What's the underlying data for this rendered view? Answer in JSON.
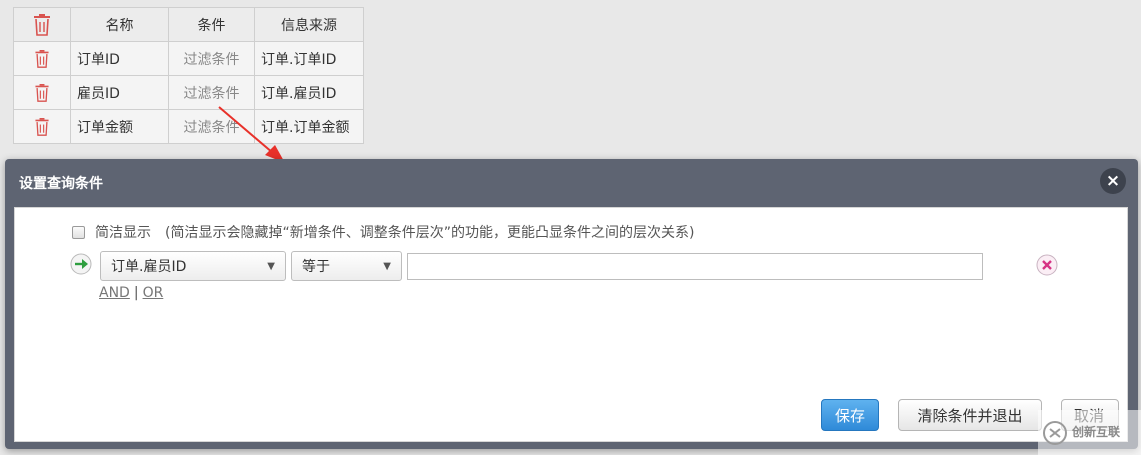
{
  "table": {
    "headers": {
      "name": "名称",
      "condition": "条件",
      "source": "信息来源"
    },
    "rows": [
      {
        "name": "订单ID",
        "condition": "过滤条件",
        "source": "订单.订单ID"
      },
      {
        "name": "雇员ID",
        "condition": "过滤条件",
        "source": "订单.雇员ID"
      },
      {
        "name": "订单金额",
        "condition": "过滤条件",
        "source": "订单.订单金额"
      }
    ]
  },
  "dialog": {
    "title": "设置查询条件",
    "close_label": "×",
    "simple_display": {
      "checked": false,
      "label": "简洁显示",
      "hint": "(简洁显示会隐藏掉“新增条件、调整条件层次”的功能，更能凸显条件之间的层次关系)"
    },
    "condition": {
      "field": "订单.雇员ID",
      "operator": "等于",
      "value": ""
    },
    "logic": {
      "and": "AND",
      "sep": "|",
      "or": "OR"
    },
    "buttons": {
      "save": "保存",
      "clear_exit": "清除条件并退出",
      "cancel": "取消"
    }
  },
  "watermark": {
    "text": "创新互联"
  },
  "colors": {
    "dialog_header": "#5e6472",
    "primary_button": "#2f8ad8",
    "trash_icon": "#d9534f",
    "go_icon": "#2e9e3f",
    "remove_icon": "#d63384"
  },
  "icons": [
    "trash-icon",
    "go-arrow-icon",
    "remove-x-icon",
    "close-icon",
    "caret-down-icon"
  ]
}
